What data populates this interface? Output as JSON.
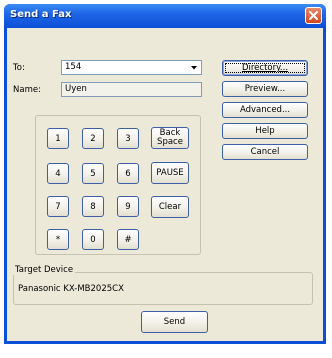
{
  "window": {
    "title": "Send a Fax",
    "titlebar_color": "#0b4fd6",
    "face_color": "#ece9d8"
  },
  "form": {
    "to_label": "To:",
    "to_value": "154",
    "name_label": "Name:",
    "name_value": "Uyen"
  },
  "keypad": {
    "keys": [
      "1",
      "2",
      "3",
      "4",
      "5",
      "6",
      "7",
      "8",
      "9",
      "*",
      "0",
      "#"
    ],
    "backspace_line1": "Back",
    "backspace_line2": "Space",
    "pause_label": "PAUSE",
    "clear_label": "Clear"
  },
  "side_buttons": {
    "directory": "Directory...",
    "preview": "Preview...",
    "advanced": "Advanced...",
    "help": "Help",
    "cancel": "Cancel"
  },
  "target": {
    "legend": "Target Device",
    "device": "Panasonic KX-MB2025CX"
  },
  "send_label": "Send",
  "icons": {
    "close": "close-icon",
    "dropdown": "chevron-down-icon"
  }
}
